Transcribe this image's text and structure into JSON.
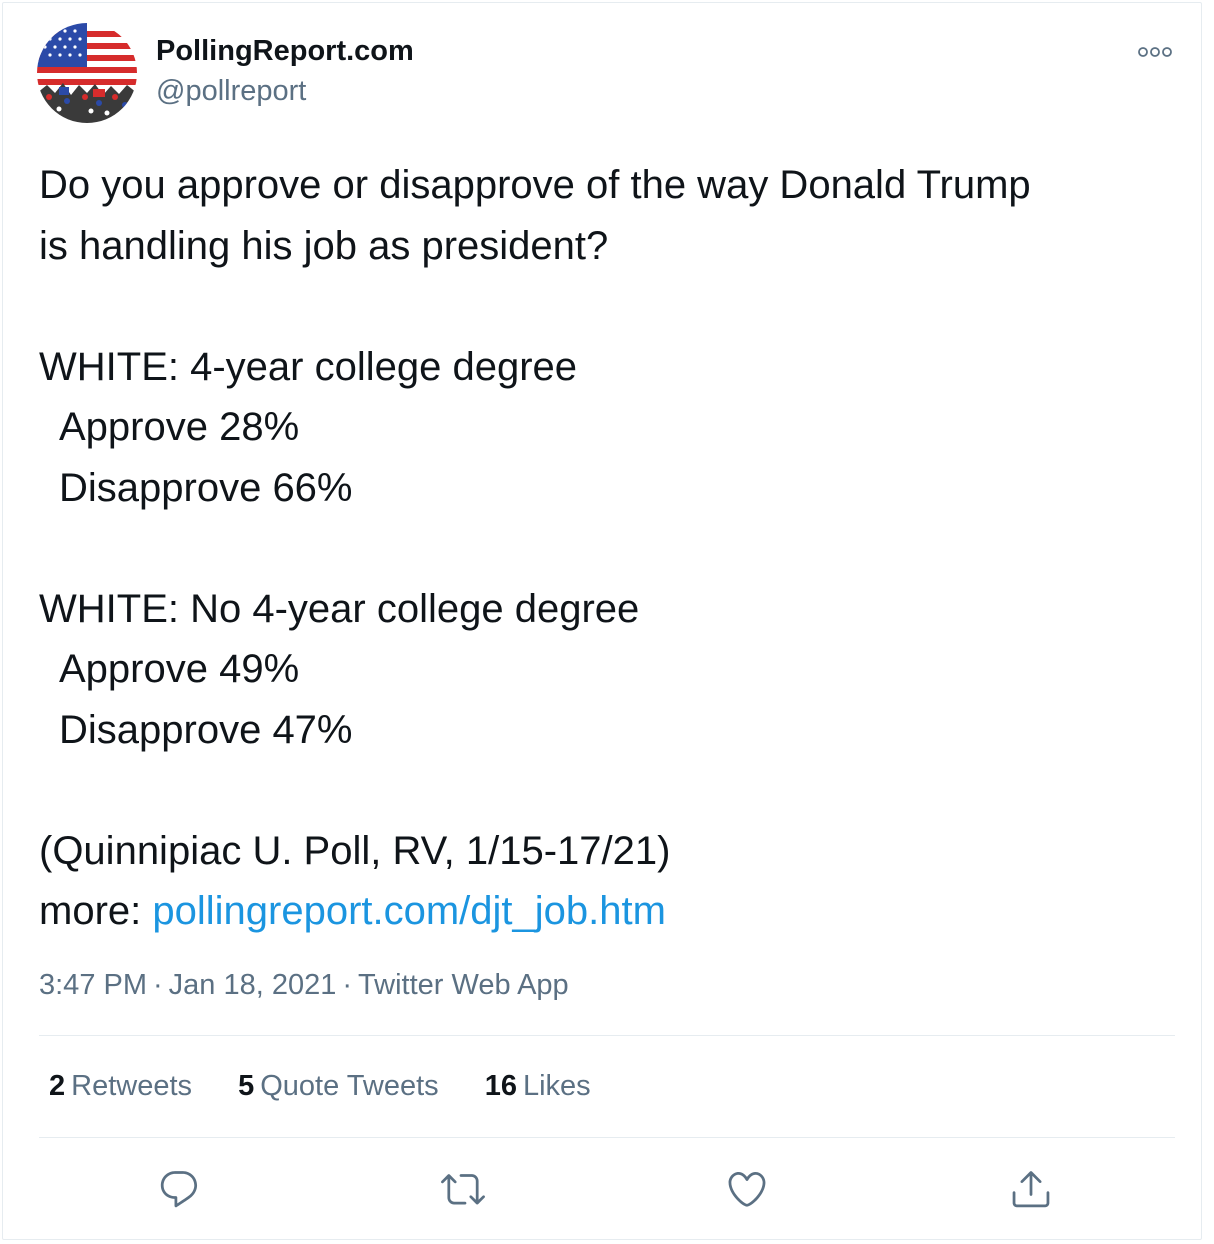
{
  "user": {
    "display_name": "PollingReport.com",
    "handle": "@pollreport",
    "avatar_icon": "us-flag-crowd-avatar"
  },
  "more_icon": "more-options-icon",
  "tweet": {
    "lines": [
      "Do you approve or disapprove of the way Donald Trump",
      "is handling his job as president?",
      "",
      "WHITE: 4-year college degree",
      "Approve 28%",
      "Disapprove 66%",
      "",
      "WHITE: No 4-year college degree",
      "Approve 49%",
      "Disapprove 47%",
      "",
      "(Quinnipiac U. Poll, RV, 1/15-17/21)"
    ],
    "more_prefix": "more: ",
    "link_text": "pollingreport.com/djt_job.htm"
  },
  "meta": {
    "time": "3:47 PM",
    "separator": "·",
    "date": "Jan 18, 2021",
    "source": "Twitter Web App"
  },
  "stats": {
    "retweets_count": "2",
    "retweets_label": "Retweets",
    "quote_count": "5",
    "quote_label": "Quote Tweets",
    "likes_count": "16",
    "likes_label": "Likes"
  },
  "actions": [
    "reply-icon",
    "retweet-icon",
    "like-icon",
    "share-icon"
  ],
  "colors": {
    "text": "#0f1419",
    "secondary": "#5b7083",
    "link": "#1b95e0",
    "border": "#e6ecf0"
  }
}
